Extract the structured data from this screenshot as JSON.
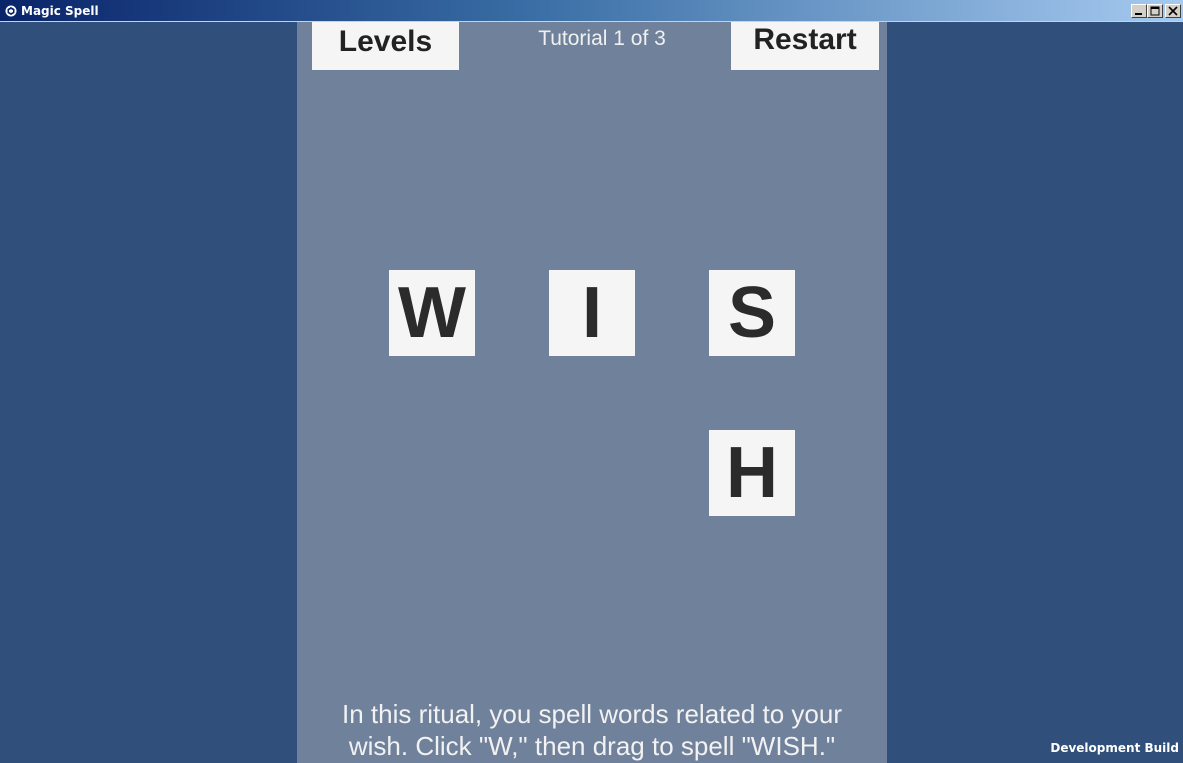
{
  "window": {
    "title": "Magic Spell",
    "icon": "unity-logo-icon",
    "controls": [
      "minimize-icon",
      "maximize-icon",
      "close-icon"
    ]
  },
  "colors": {
    "background": "#30507b",
    "board": "#70819b",
    "tile": "#f5f5f5",
    "tile_text": "#2b2b2b",
    "label_text": "#f2f2f2"
  },
  "header": {
    "levels_label": "Levels",
    "tutorial_label": "Tutorial 1 of 3",
    "restart_label": "Restart"
  },
  "tiles": [
    {
      "letter": "W"
    },
    {
      "letter": "I"
    },
    {
      "letter": "S"
    },
    {
      "letter": "H"
    }
  ],
  "instructions": {
    "line1": "In this ritual, you spell words related to your",
    "line2": "wish. Click \"W,\" then drag to spell \"WISH.\""
  },
  "footer": {
    "build_label": "Development Build"
  }
}
